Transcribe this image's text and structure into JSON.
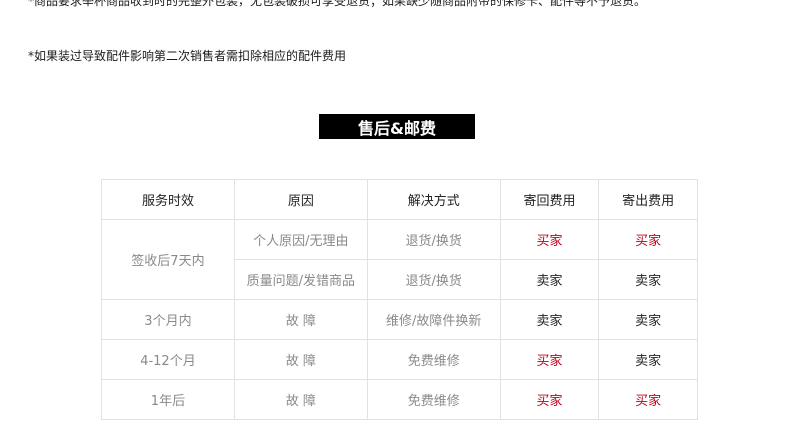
{
  "notes": {
    "line1": "*商品要求举杯商品收到时的完整外包装，无包装破损可享受退货；如果缺少随商品附带的保修卡、配件等不予退货。",
    "line2": "*如果装过导致配件影响第二次销售者需扣除相应的配件费用"
  },
  "banner": {
    "title": "售后&邮费"
  },
  "table": {
    "headers": [
      "服务时效",
      "原因",
      "解决方式",
      "寄回费用",
      "寄出费用"
    ],
    "rows": [
      {
        "period": "签收后7天内",
        "reason": "个人原因/无理由",
        "solution": "退货/换货",
        "return_fee": "买家",
        "ship_fee": "买家"
      },
      {
        "period": "",
        "reason": "质量问题/发错商品",
        "solution": "退货/换货",
        "return_fee": "卖家",
        "ship_fee": "卖家"
      },
      {
        "period": "3个月内",
        "reason": "故 障",
        "solution": "维修/故障件换新",
        "return_fee": "卖家",
        "ship_fee": "卖家"
      },
      {
        "period": "4-12个月",
        "reason": "故 障",
        "solution": "免费维修",
        "return_fee": "买家",
        "ship_fee": "卖家"
      },
      {
        "period": "1年后",
        "reason": "故 障",
        "solution": "免费维修",
        "return_fee": "买家",
        "ship_fee": "买家"
      }
    ]
  },
  "colors": {
    "buyer": "#c0001a",
    "seller": "#222222",
    "muted": "#8a8a8a"
  }
}
